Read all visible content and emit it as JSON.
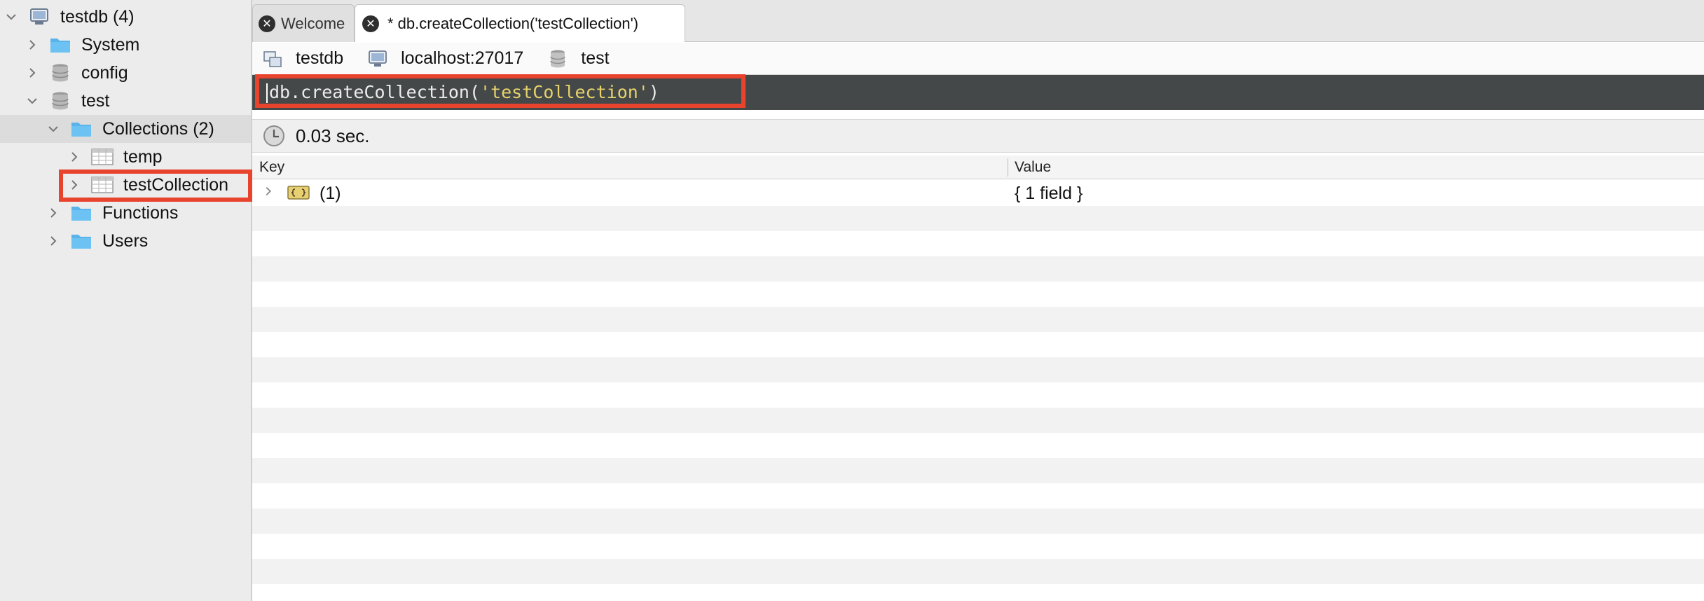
{
  "sidebar": {
    "root": {
      "label": "testdb (4)",
      "expanded": true
    },
    "items": [
      {
        "label": "System",
        "expanded": false
      },
      {
        "label": "config",
        "expanded": false
      },
      {
        "label": "test",
        "expanded": true
      },
      {
        "label": "Collections (2)",
        "expanded": true,
        "selected": true
      },
      {
        "label": "temp",
        "expanded": false
      },
      {
        "label": "testCollection",
        "expanded": false,
        "highlighted": true
      },
      {
        "label": "Functions",
        "expanded": false
      },
      {
        "label": "Users",
        "expanded": false
      }
    ]
  },
  "tabs": [
    {
      "label": "Welcome",
      "close_icon": "close-icon",
      "active": false
    },
    {
      "label": "* db.createCollection('testCollection')",
      "close_icon": "close-icon",
      "active": true
    }
  ],
  "connection": {
    "database_name": "testdb",
    "host": "localhost:27017",
    "db": "test"
  },
  "query": {
    "prefix": "db.createCollection(",
    "string_arg": "'testCollection'",
    "suffix": ")"
  },
  "execution": {
    "time": "0.03 sec."
  },
  "results": {
    "columns": [
      "Key",
      "Value"
    ],
    "rows": [
      {
        "key": "(1)",
        "value": "{ 1 field }"
      }
    ]
  },
  "colors": {
    "highlight": "#e8432d",
    "editor_bg": "#454849",
    "string_literal": "#e6d36b",
    "folder": "#5ab4ea"
  }
}
